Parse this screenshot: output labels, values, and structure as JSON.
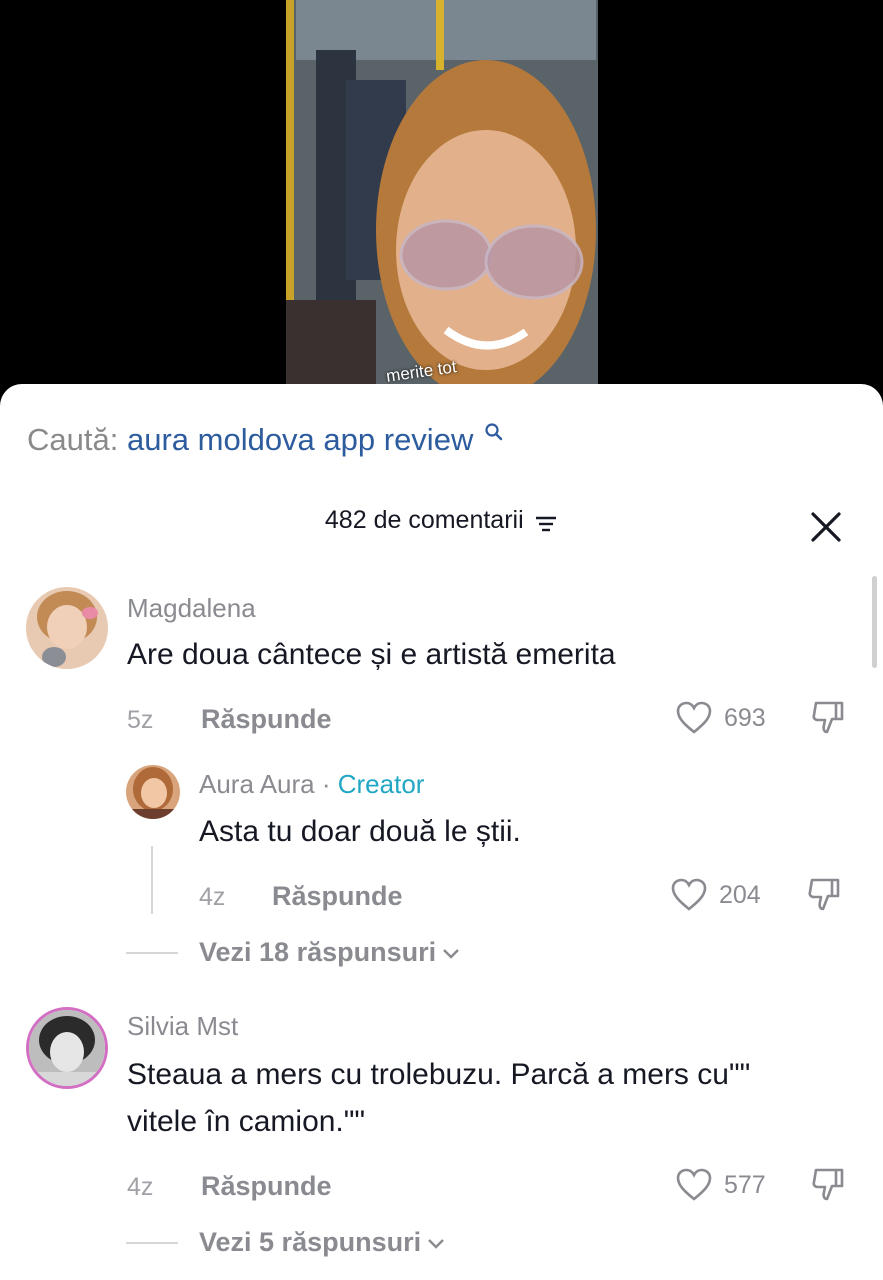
{
  "video": {
    "caption": "merite tot"
  },
  "search": {
    "prefix": "Caută:",
    "query": "aura moldova app review"
  },
  "header": {
    "count_label": "482 de comentarii"
  },
  "comments": [
    {
      "user": "Magdalena",
      "text": "Are doua cântece și e artistă emerita",
      "age": "5z",
      "reply_label": "Răspunde",
      "likes": "693",
      "reply": {
        "user": "Aura Aura",
        "separator": " · ",
        "badge": "Creator",
        "text": "Asta tu doar două le știi.",
        "age": "4z",
        "reply_label": "Răspunde",
        "likes": "204"
      },
      "view_replies": "Vezi 18 răspunsuri"
    },
    {
      "user": "Silvia Mst",
      "text_line1": "Steaua a mers cu trolebuzu. Parcă a mers cu\"\"",
      "text_line2": "vitele în camion.\"\"",
      "age": "4z",
      "reply_label": "Răspunde",
      "likes": "577",
      "view_replies": "Vezi 5 răspunsuri"
    }
  ],
  "colors": {
    "creator": "#21a7c4",
    "search_query": "#2d5c9e",
    "text": "#161823",
    "muted": "#8a8b91"
  }
}
